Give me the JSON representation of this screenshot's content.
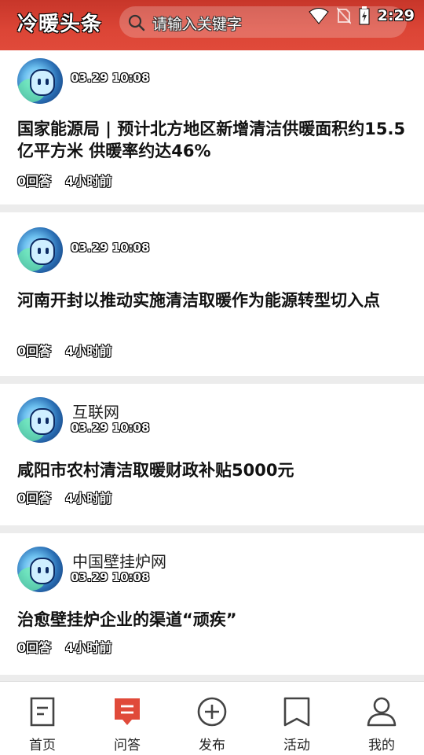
{
  "header": {
    "title": "冷暖头条",
    "search_placeholder": "请输入关键字",
    "clock": "2:29",
    "accent_color": "#dc4536"
  },
  "feed": [
    {
      "source": "",
      "date": "03.29 10:08",
      "headline": "国家能源局 | 预计北方地区新增清洁供暖面积约15.5亿平方米 供暖率约达46%",
      "answers": "0回答",
      "time_ago": "4小时前"
    },
    {
      "source": "",
      "date": "03.29 10:08",
      "headline": "河南开封以推动实施清洁取暖作为能源转型切入点",
      "answers": "0回答",
      "time_ago": "4小时前"
    },
    {
      "source": "互联网",
      "date": "03.29 10:08",
      "headline": "咸阳市农村清洁取暖财政补贴5000元",
      "answers": "0回答",
      "time_ago": "4小时前"
    },
    {
      "source": "中国壁挂炉网",
      "date": "03.29 10:08",
      "headline": "治愈壁挂炉企业的渠道“顽疾”",
      "answers": "0回答",
      "time_ago": "4小时前"
    }
  ],
  "tabs": [
    {
      "label": "首页",
      "icon": "home-doc-icon"
    },
    {
      "label": "问答",
      "icon": "qa-chat-icon",
      "active": true
    },
    {
      "label": "发布",
      "icon": "plus-circle-icon"
    },
    {
      "label": "活动",
      "icon": "bookmark-icon"
    },
    {
      "label": "我的",
      "icon": "user-icon"
    }
  ]
}
